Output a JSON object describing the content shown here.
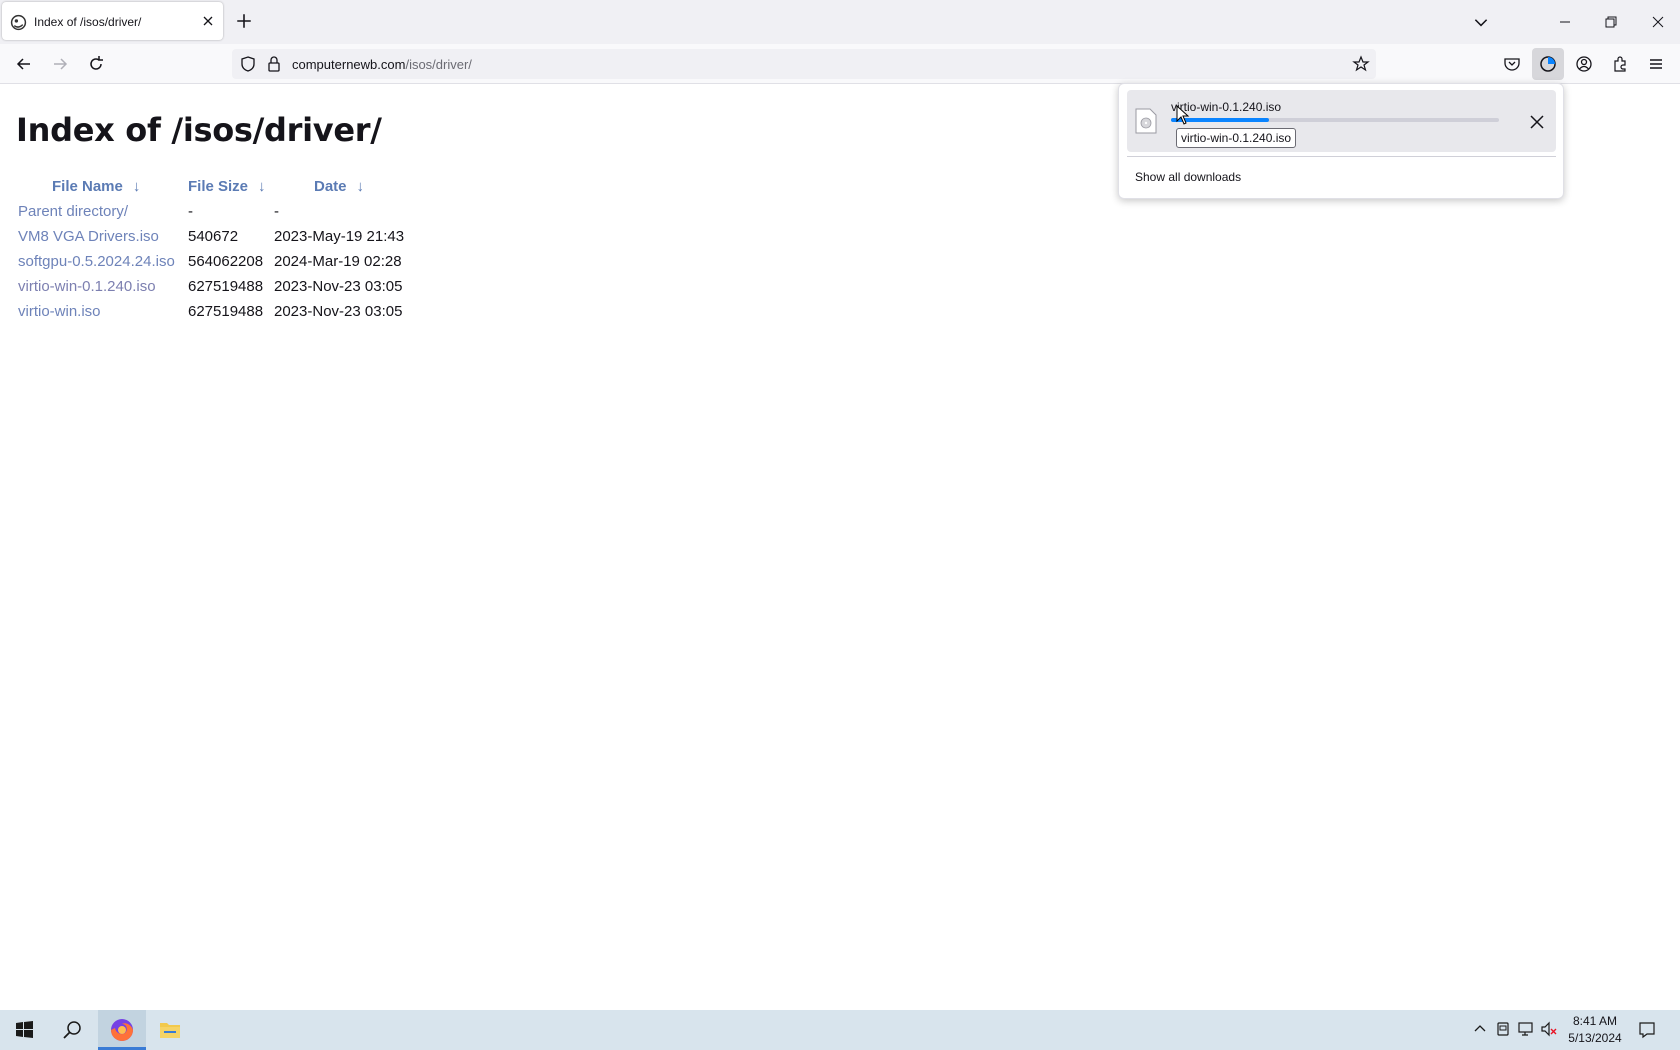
{
  "browser": {
    "tab_title": "Index of /isos/driver/",
    "url_domain": "computernewb.com",
    "url_path": "/isos/driver/"
  },
  "page": {
    "title": "Index of /isos/driver/",
    "columns": {
      "name": "File Name",
      "size": "File Size",
      "date": "Date",
      "sort_arrow": "↓"
    },
    "rows": [
      {
        "name": "Parent directory/",
        "size": "-",
        "date": "-"
      },
      {
        "name": "VM8 VGA Drivers.iso",
        "size": "540672",
        "date": "2023-May-19 21:43"
      },
      {
        "name": "softgpu-0.5.2024.24.iso",
        "size": "564062208",
        "date": "2024-Mar-19 02:28"
      },
      {
        "name": "virtio-win-0.1.240.iso",
        "size": "627519488",
        "date": "2023-Nov-23 03:05"
      },
      {
        "name": "virtio-win.iso",
        "size": "627519488",
        "date": "2023-Nov-23 03:05"
      }
    ]
  },
  "downloads": {
    "file_name": "virtio-win-0.1.240.iso",
    "progress": 0.3,
    "tooltip": "virtio-win-0.1.240.iso",
    "show_all": "Show all downloads"
  },
  "taskbar": {
    "time": "8:41 AM",
    "date": "5/13/2024"
  },
  "colors": {
    "accent": "#0a84ff",
    "link": "#6e83b9",
    "taskbar": "#d8e4ed"
  }
}
